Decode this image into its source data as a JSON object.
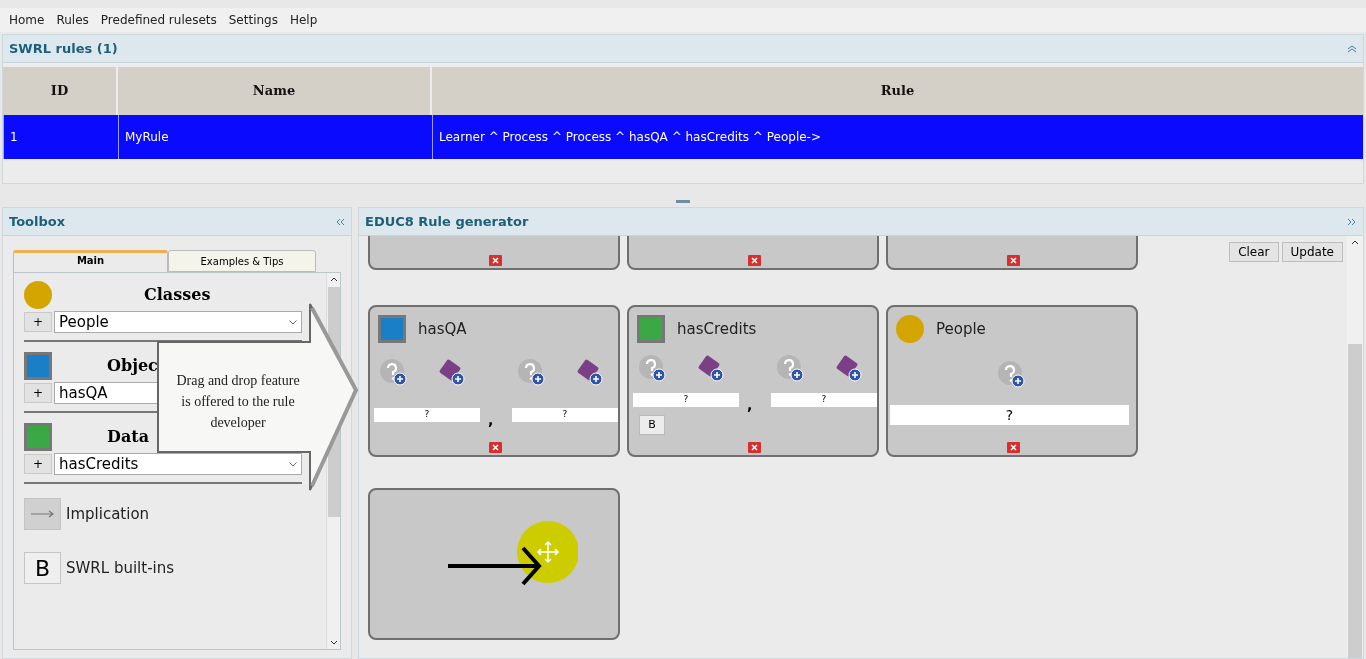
{
  "menu": [
    "Home",
    "Rules",
    "Predefined rulesets",
    "Settings",
    "Help"
  ],
  "rules_panel": {
    "title": "SWRL rules (1)",
    "columns": [
      "ID",
      "Name",
      "Rule"
    ],
    "rows": [
      {
        "id": "1",
        "name": "MyRule",
        "rule": "Learner ^ Process ^ Process ^ hasQA ^ hasCredits ^ People->",
        "selected": true
      }
    ]
  },
  "toolbox": {
    "title": "Toolbox",
    "tabs": [
      {
        "label": "Main",
        "selected": true
      },
      {
        "label": "Examples & Tips",
        "selected": false
      }
    ],
    "sections": [
      {
        "kind": "class",
        "heading": "Classes",
        "add_label": "+",
        "value": "People"
      },
      {
        "kind": "object",
        "heading": "Objec",
        "add_label": "+",
        "value": "hasQA"
      },
      {
        "kind": "data",
        "heading": "Data",
        "add_label": "+",
        "value": "hasCredits"
      }
    ],
    "items": [
      {
        "kind": "implication",
        "label": "Implication"
      },
      {
        "kind": "builtin",
        "icon_text": "B",
        "label": "SWRL built-ins"
      }
    ]
  },
  "callout": {
    "text": "Drag and drop feature is offered to the rule developer"
  },
  "generator": {
    "title": "EDUC8 Rule generator",
    "buttons": [
      "Clear",
      "Update"
    ],
    "atoms": [
      {
        "kind": "partial"
      },
      {
        "kind": "partial"
      },
      {
        "kind": "partial"
      },
      {
        "kind": "object",
        "name": "hasQA",
        "args": [
          "?",
          "?"
        ],
        "separator": ","
      },
      {
        "kind": "data",
        "name": "hasCredits",
        "args": [
          "?",
          "?"
        ],
        "separator": ",",
        "builtin": "B"
      },
      {
        "kind": "class",
        "name": "People",
        "args": [
          "?"
        ]
      },
      {
        "kind": "implication"
      }
    ]
  }
}
